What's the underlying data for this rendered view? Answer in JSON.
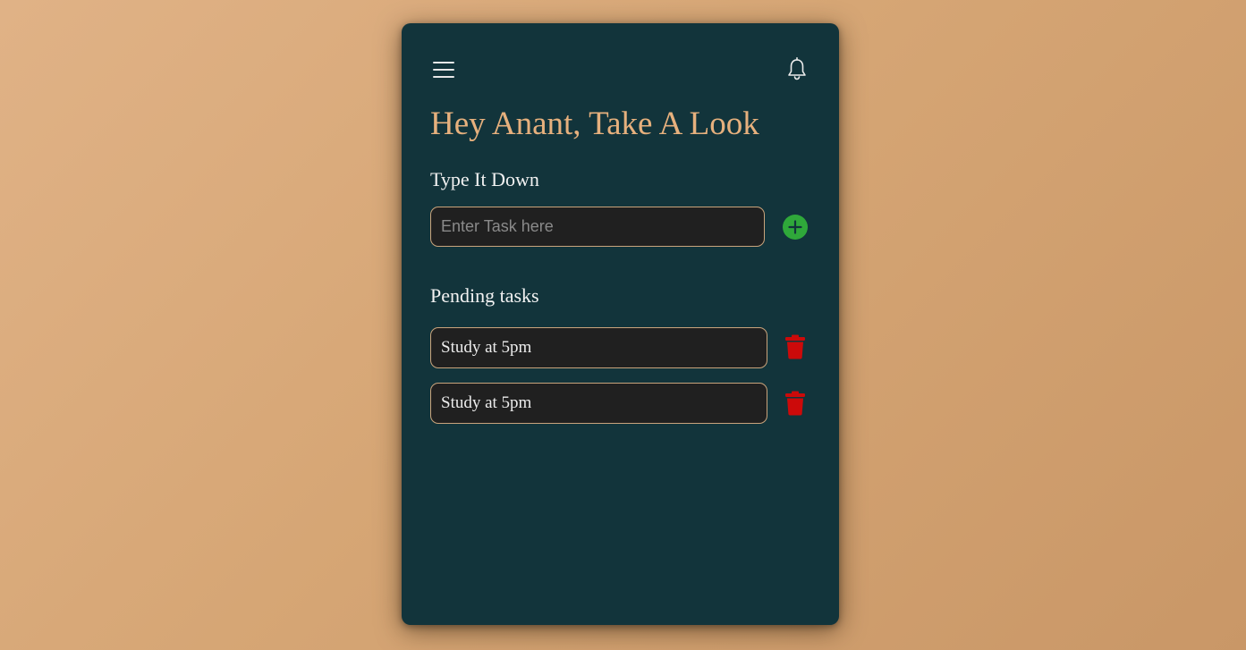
{
  "header": {
    "menu_icon": "hamburger-menu-icon",
    "notification_icon": "bell-icon"
  },
  "greeting": "Hey Anant, Take A Look",
  "input_section": {
    "label": "Type It Down",
    "placeholder": "Enter Task here",
    "value": "",
    "add_icon": "plus-circle-icon",
    "add_color": "#2fa83a"
  },
  "pending": {
    "label": "Pending tasks",
    "delete_icon": "trash-icon",
    "delete_color": "#cc0a0a",
    "tasks": [
      {
        "text": "Study at 5pm"
      },
      {
        "text": "Study at 5pm"
      }
    ]
  },
  "colors": {
    "accent": "#e6b07d",
    "card_background": "#12343b",
    "field_background": "#202020",
    "field_border": "#c9a47c"
  }
}
